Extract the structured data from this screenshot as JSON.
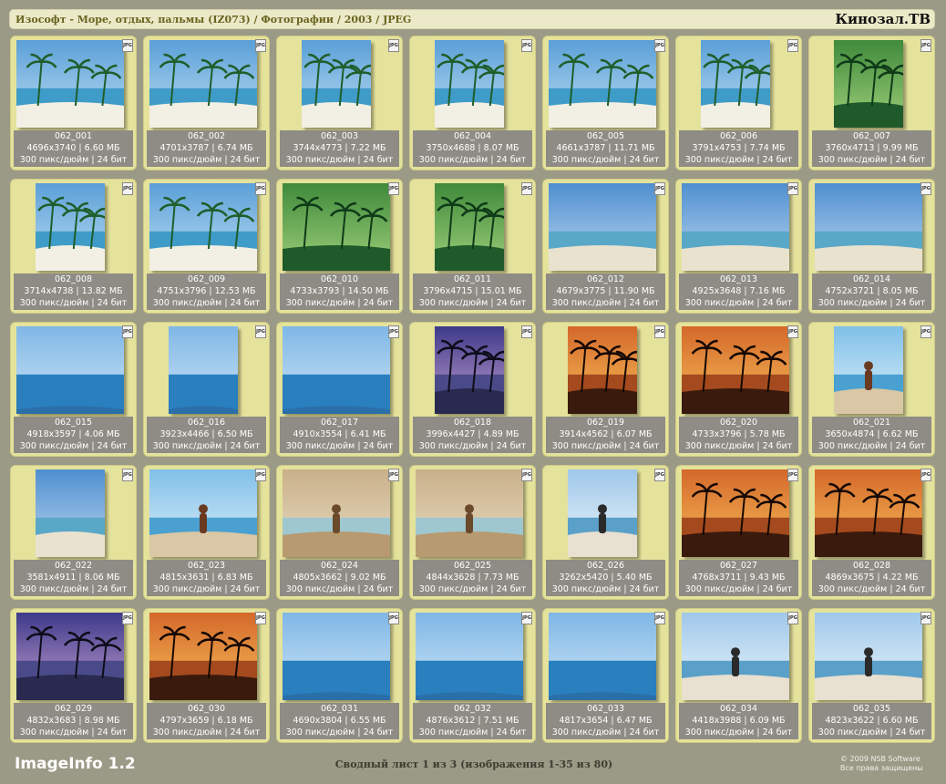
{
  "header": {
    "path": "Изософт - Море, отдых, пальмы (IZ073) / Фотографии / 2003 / JPEG",
    "logo": "Кинозал.ТВ"
  },
  "badge_label": "JPG",
  "thumbnails": [
    {
      "name": "062_001",
      "size": "4696x3740 | 6.60 МБ",
      "res": "300 пикс/дюйм | 24 бит",
      "scene": "beach",
      "orient": "land"
    },
    {
      "name": "062_002",
      "size": "4701x3787 | 6.74 МБ",
      "res": "300 пикс/дюйм | 24 бит",
      "scene": "beach",
      "orient": "land"
    },
    {
      "name": "062_003",
      "size": "3744x4773 | 7.22 МБ",
      "res": "300 пикс/дюйм | 24 бит",
      "scene": "beach",
      "orient": "port"
    },
    {
      "name": "062_004",
      "size": "3750x4688 | 8.07 МБ",
      "res": "300 пикс/дюйм | 24 бит",
      "scene": "beach",
      "orient": "port"
    },
    {
      "name": "062_005",
      "size": "4661x3787 | 11.71 МБ",
      "res": "300 пикс/дюйм | 24 бит",
      "scene": "beach",
      "orient": "land"
    },
    {
      "name": "062_006",
      "size": "3791x4753 | 7.74 МБ",
      "res": "300 пикс/дюйм | 24 бит",
      "scene": "beach",
      "orient": "port"
    },
    {
      "name": "062_007",
      "size": "3760x4713 | 9.99 МБ",
      "res": "300 пикс/дюйм | 24 бит",
      "scene": "green",
      "orient": "port"
    },
    {
      "name": "062_008",
      "size": "3714x4738 | 13.82 МБ",
      "res": "300 пикс/дюйм | 24 бит",
      "scene": "beach",
      "orient": "port"
    },
    {
      "name": "062_009",
      "size": "4751x3796 | 12.53 МБ",
      "res": "300 пикс/дюйм | 24 бит",
      "scene": "beach",
      "orient": "land"
    },
    {
      "name": "062_010",
      "size": "4733x3793 | 14.50 МБ",
      "res": "300 пикс/дюйм | 24 бит",
      "scene": "green",
      "orient": "land"
    },
    {
      "name": "062_011",
      "size": "3796x4715 | 15.01 МБ",
      "res": "300 пикс/дюйм | 24 бит",
      "scene": "green",
      "orient": "port"
    },
    {
      "name": "062_012",
      "size": "4679x3775 | 11.90 МБ",
      "res": "300 пикс/дюйм | 24 бит",
      "scene": "shore",
      "orient": "land"
    },
    {
      "name": "062_013",
      "size": "4925x3648 | 7.16 МБ",
      "res": "300 пикс/дюйм | 24 бит",
      "scene": "shore",
      "orient": "land"
    },
    {
      "name": "062_014",
      "size": "4752x3721 | 8.05 МБ",
      "res": "300 пикс/дюйм | 24 бит",
      "scene": "shore",
      "orient": "land"
    },
    {
      "name": "062_015",
      "size": "4918x3597 | 4.06 МБ",
      "res": "300 пикс/дюйм | 24 бит",
      "scene": "sea",
      "orient": "land"
    },
    {
      "name": "062_016",
      "size": "3923x4466 | 6.50 МБ",
      "res": "300 пикс/дюйм | 24 бит",
      "scene": "sea",
      "orient": "port"
    },
    {
      "name": "062_017",
      "size": "4910x3554 | 6.41 МБ",
      "res": "300 пикс/дюйм | 24 бит",
      "scene": "sea",
      "orient": "land"
    },
    {
      "name": "062_018",
      "size": "3996x4427 | 4.89 МБ",
      "res": "300 пикс/дюйм | 24 бит",
      "scene": "dusk",
      "orient": "port"
    },
    {
      "name": "062_019",
      "size": "3914x4562 | 6.07 МБ",
      "res": "300 пикс/дюйм | 24 бит",
      "scene": "sunset",
      "orient": "port"
    },
    {
      "name": "062_020",
      "size": "4733x3796 | 5.78 МБ",
      "res": "300 пикс/дюйм | 24 бит",
      "scene": "sunset",
      "orient": "land"
    },
    {
      "name": "062_021",
      "size": "3650x4874 | 6.62 МБ",
      "res": "300 пикс/дюйм | 24 бит",
      "scene": "people",
      "orient": "port"
    },
    {
      "name": "062_022",
      "size": "3581x4911 | 8.06 МБ",
      "res": "300 пикс/дюйм | 24 бит",
      "scene": "shore",
      "orient": "port"
    },
    {
      "name": "062_023",
      "size": "4815x3631 | 6.83 МБ",
      "res": "300 пикс/дюйм | 24 бит",
      "scene": "people",
      "orient": "land"
    },
    {
      "name": "062_024",
      "size": "4805x3662 | 9.02 МБ",
      "res": "300 пикс/дюйм | 24 бит",
      "scene": "sand",
      "orient": "land"
    },
    {
      "name": "062_025",
      "size": "4844x3628 | 7.73 МБ",
      "res": "300 пикс/дюйм | 24 бит",
      "scene": "sand",
      "orient": "land"
    },
    {
      "name": "062_026",
      "size": "3262x5420 | 5.40 МБ",
      "res": "300 пикс/дюйм | 24 бит",
      "scene": "pale",
      "orient": "port"
    },
    {
      "name": "062_027",
      "size": "4768x3711 | 9.43 МБ",
      "res": "300 пикс/дюйм | 24 бит",
      "scene": "sunset",
      "orient": "land"
    },
    {
      "name": "062_028",
      "size": "4869x3675 | 4.22 МБ",
      "res": "300 пикс/дюйм | 24 бит",
      "scene": "sunset",
      "orient": "land"
    },
    {
      "name": "062_029",
      "size": "4832x3683 | 8.98 МБ",
      "res": "300 пикс/дюйм | 24 бит",
      "scene": "dusk",
      "orient": "land"
    },
    {
      "name": "062_030",
      "size": "4797x3659 | 6.18 МБ",
      "res": "300 пикс/дюйм | 24 бит",
      "scene": "sunset",
      "orient": "land"
    },
    {
      "name": "062_031",
      "size": "4690x3804 | 6.55 МБ",
      "res": "300 пикс/дюйм | 24 бит",
      "scene": "sea",
      "orient": "land"
    },
    {
      "name": "062_032",
      "size": "4876x3612 | 7.51 МБ",
      "res": "300 пикс/дюйм | 24 бит",
      "scene": "sea",
      "orient": "land"
    },
    {
      "name": "062_033",
      "size": "4817x3654 | 6.47 МБ",
      "res": "300 пикс/дюйм | 24 бит",
      "scene": "sea",
      "orient": "land"
    },
    {
      "name": "062_034",
      "size": "4418x3988 | 6.09 МБ",
      "res": "300 пикс/дюйм | 24 бит",
      "scene": "pale",
      "orient": "land"
    },
    {
      "name": "062_035",
      "size": "4823x3622 | 6.60 МБ",
      "res": "300 пикс/дюйм | 24 бит",
      "scene": "pale",
      "orient": "land"
    }
  ],
  "footer": {
    "brand": "ImageInfo 1.2",
    "summary": "Сводный лист 1 из 3 (изображения 1-35 из 80)",
    "copyright": "© 2009 NSB Software",
    "rights": "Все права защищены"
  },
  "colors": {
    "background": "#9b9a87",
    "cell": "#e5e29b",
    "caption": "#8e8c85"
  }
}
